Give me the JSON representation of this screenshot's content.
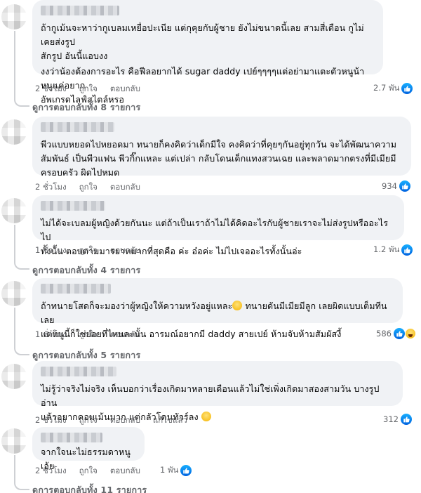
{
  "colors": {
    "like_blue": "#0866ff",
    "bubble_bg": "#f0f2f5",
    "meta_gray": "#65676b"
  },
  "comments": [
    {
      "lines": [
        "ถ้ากูเม้นจะหาว่ากูเบลมเหยื่อปะเนีย แต่กุคุยกับผู้ชาย ยังไม่ขนาดนี้เลย สามสี่เดือน กูไม่เคยส่งรูป\nสักรูป อันนี้แอบงง",
        "งงว่าน้องต้องการอะไร คือฟีลอยากได้ sugar daddy เปย์ๆๆๆๆแต่อย่ามาแตะตัวหนูน้า หนูแค่อยาก\nอัพเกรดไลฟ์สไตล์หรอ"
      ],
      "time": "2 ชั่วโมง",
      "like": "ถูกใจ",
      "reply": "ตอบกลับ",
      "reaction_count": "2.7 พัน",
      "reactions": [
        "like-icon"
      ],
      "view_replies": "ดูการตอบกลับทั้ง 8 รายการ"
    },
    {
      "lines": [
        "พีวแบบหยอดไปหยอดมา ทนายก็คงคิดว่าเด็กมีใจ คงคิดว่าที่คุยๆกันอยู่ทุกวัน จะได้พัฒนาความ\nสัมพันธ์ เป็นพีวแฟน พีวกิ๊กแหละ แต่เปล่า กลับโดนเด็กแทงสวนเฉย และพลาดมากตรงที่มีเมียมี\nครอบครัว ผิดไปหมด"
      ],
      "time": "2 ชั่วโมง",
      "like": "ถูกใจ",
      "reply": "ตอบกลับ",
      "reaction_count": "934",
      "reactions": [
        "like-icon"
      ]
    },
    {
      "lines": [
        "ไม่ได้จะเบลมผู้หญิงด้วยกันนะ แต่ถ้าเป็นเราถ้าไม่ได้คิดอะไรกับผู้ชายเราจะไม่ส่งรูปหรืออะไรไป\nทั้งนั้น ตอบตามมารยาทมากที่สุดคือ ค่ะ อ๋อค่ะ ไม่ไปเจออะไรทั้งนั้นอ่ะ"
      ],
      "time": "1 ชั่วโมง",
      "like": "ถูกใจ",
      "reply": "ตอบกลับ",
      "reaction_count": "1.2 พัน",
      "reactions": [
        "like-icon"
      ],
      "view_replies": "ดูการตอบกลับทั้ง 4 รายการ"
    },
    {
      "lines": [
        "ถ้าทนายโสดก็จะมองว่าผู้หญิงให้ความหวังอยู่แหละ",
        " ทนายดันมีเมียมีลูก เลยผิดแบบเต็มทีนเลย\nแต่หนูนี้ก็ใช่ย่อยที่ไหนละนั้น อารมณ์อยากมี daddy สายเปย์ ห้ามจับห้ามสัมผัสงี้"
      ],
      "time": "1 ชั่วโมง",
      "like": "ถูกใจ",
      "reply": "ตอบกลับ",
      "reaction_count": "586",
      "reactions": [
        "like-icon",
        "haha-icon"
      ],
      "view_replies": "ดูการตอบกลับทั้ง 5 รายการ"
    },
    {
      "lines": [
        "ไม่รู้ว่าจริงไม่จริง เห็นบอกว่าเรื่องเกิดมาหลายเดือนแล้วไม่ใช่เพิ่งเกิดมาสองสามวัน บางรูปอ่าน\nแล้วอยากคอมเม้นมาก แต่กลัวโดนทัวร์ลง"
      ],
      "time": "2 ชั่วโมง",
      "like": "ถูกใจ",
      "reply": "ตอบกลับ",
      "edited": "แก้ไขแล้ว",
      "reaction_count": "312",
      "reactions": [
        "like-icon"
      ]
    },
    {
      "lines": [
        "จากใจนะไม่ธรรมดาหนูเอ้ย"
      ],
      "time": "2 ชั่วโมง",
      "like": "ถูกใจ",
      "reply": "ตอบกลับ",
      "reaction_count": "1 พัน",
      "reactions": [
        "like-icon"
      ],
      "view_replies": "ดูการตอบกลับทั้ง 11 รายการ"
    }
  ]
}
